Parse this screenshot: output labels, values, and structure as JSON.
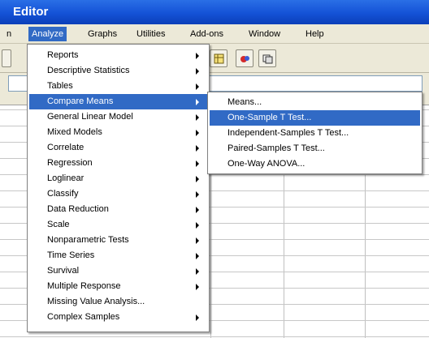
{
  "window": {
    "title": "Editor"
  },
  "menubar": {
    "items": [
      {
        "label": "n"
      },
      {
        "label": "Analyze"
      },
      {
        "label": "Graphs"
      },
      {
        "label": "Utilities"
      },
      {
        "label": "Add-ons"
      },
      {
        "label": "Window"
      },
      {
        "label": "Help"
      }
    ]
  },
  "analyze_menu": {
    "items": [
      {
        "label": "Reports"
      },
      {
        "label": "Descriptive Statistics"
      },
      {
        "label": "Tables"
      },
      {
        "label": "Compare Means"
      },
      {
        "label": "General Linear Model"
      },
      {
        "label": "Mixed Models"
      },
      {
        "label": "Correlate"
      },
      {
        "label": "Regression"
      },
      {
        "label": "Loglinear"
      },
      {
        "label": "Classify"
      },
      {
        "label": "Data Reduction"
      },
      {
        "label": "Scale"
      },
      {
        "label": "Nonparametric Tests"
      },
      {
        "label": "Time Series"
      },
      {
        "label": "Survival"
      },
      {
        "label": "Multiple Response"
      },
      {
        "label": "Missing Value Analysis..."
      },
      {
        "label": "Complex Samples"
      }
    ]
  },
  "compare_means_submenu": {
    "items": [
      {
        "label": "Means..."
      },
      {
        "label": "One-Sample T Test..."
      },
      {
        "label": "Independent-Samples T Test..."
      },
      {
        "label": "Paired-Samples T Test..."
      },
      {
        "label": "One-Way ANOVA..."
      }
    ]
  },
  "colors": {
    "highlight": "#316ac5",
    "titlebar": "#1452d6",
    "chrome": "#ece9d8"
  }
}
